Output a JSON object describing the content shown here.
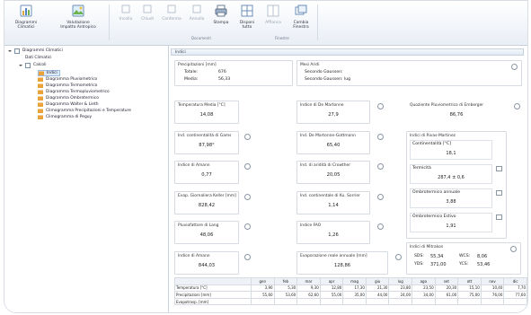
{
  "ribbon": {
    "buttons": [
      {
        "label": "Diagrammi\nClimatici",
        "icon": "chart-icon"
      },
      {
        "label": "Valutazione\nImpatto Antropico",
        "icon": "landscape-icon"
      },
      {
        "label": "Incolla",
        "icon": "paste-icon"
      },
      {
        "label": "Chiudi",
        "icon": "close-doc-icon"
      },
      {
        "label": "Conferma",
        "icon": "confirm-icon"
      },
      {
        "label": "Annulla",
        "icon": "undo-icon"
      },
      {
        "label": "Stampa",
        "icon": "print-icon"
      },
      {
        "label": "Disponi\ntutto",
        "icon": "tile-icon"
      },
      {
        "label": "Affianca",
        "icon": "side-by-side-icon"
      },
      {
        "label": "Cambia\nFinestra",
        "icon": "switch-window-icon"
      }
    ],
    "groups": [
      "Documenti",
      "Finestre"
    ]
  },
  "tree": {
    "items": [
      {
        "label": "Diagrammi Climatici",
        "icon": "document-icon",
        "level": 0,
        "expanded": true
      },
      {
        "label": "Dati Climatici",
        "icon": "none",
        "level": 1
      },
      {
        "label": "Calcoli",
        "icon": "document-icon",
        "level": 1,
        "expanded": true
      },
      {
        "label": "Indici",
        "icon": "folder-icon",
        "level": 2,
        "selected": true
      },
      {
        "label": "Diagramma Pluviometrico",
        "icon": "folder-icon",
        "level": 2
      },
      {
        "label": "Diagramma Termometrico",
        "icon": "folder-icon",
        "level": 2
      },
      {
        "label": "Diagramma Termopluviometrico",
        "icon": "folder-icon",
        "level": 2
      },
      {
        "label": "Diagramma Ombrotermico",
        "icon": "folder-icon",
        "level": 2
      },
      {
        "label": "Diagramma Walter & Lieth",
        "icon": "folder-icon",
        "level": 2
      },
      {
        "label": "Climogramma Precipitazioni e Temperature",
        "icon": "folder-icon",
        "level": 2
      },
      {
        "label": "Climogramma di Peguy",
        "icon": "folder-icon",
        "level": 2
      }
    ]
  },
  "content": {
    "header": "Indici",
    "precipitazioni": {
      "title": "Precipitazioni [mm]",
      "rows": [
        {
          "k": "Totale:",
          "v": "676"
        },
        {
          "k": "Media:",
          "v": "56,33"
        }
      ]
    },
    "mesi_aridi": {
      "title": "Mesi Aridi",
      "rows": [
        "Secondo Gaussen:",
        "Secondo Gaussen: lug"
      ]
    },
    "cards": [
      {
        "label": "Temperatura Media [°C]",
        "value": "14,08"
      },
      {
        "label": "Indice di De Martonne",
        "value": "27,9"
      },
      {
        "label": "Quoziente Pluviometrico di Emberger",
        "value": "86,76"
      },
      {
        "label": "Ind. continentalità di Gams",
        "value": "87,98°"
      },
      {
        "label": "Ind. De Martonne-Gottmann",
        "value": "65,40"
      },
      {
        "label": "Indice di Amann",
        "value": "0,77"
      },
      {
        "label": "Ind. di aridità di Crowther",
        "value": "20,05"
      },
      {
        "label": "Evap. Giornaliera Keller [mm]",
        "value": "828,42"
      },
      {
        "label": "Ind. continentale di Ku. Sorrier",
        "value": "1,14"
      },
      {
        "label": "Pluviofattore di Lang",
        "value": "48,06"
      },
      {
        "label": "Indice FAO",
        "value": "1,26"
      },
      {
        "label": "Indice di Amann",
        "value": "844,03"
      },
      {
        "label": "Evaporazione reale annuale [mm]",
        "value": "128,86"
      }
    ],
    "rivas": {
      "title": "Indici di Rivas-Martinez",
      "items": [
        {
          "label": "Continentalità [°C]",
          "value": "18,1"
        },
        {
          "label": "Termicità",
          "value": "287,4 ± 0,6"
        },
        {
          "label": "Ombrotermico annuale",
          "value": "3,88"
        },
        {
          "label": "Ombrotermico Estivo",
          "value": "1,91"
        }
      ]
    },
    "mitrakos": {
      "title": "Indici di Mitrakos",
      "rows": [
        {
          "a": "SDS:",
          "b": "55,34",
          "c": "WCS:",
          "d": "8,06"
        },
        {
          "a": "YDS:",
          "b": "371,00",
          "c": "YCS:",
          "d": "53,46"
        }
      ]
    },
    "table": {
      "headers": [
        "",
        "gen",
        "feb",
        "mar",
        "apr",
        "mag",
        "giu",
        "lug",
        "ago",
        "set",
        "ott",
        "nov",
        "dic"
      ],
      "rows": [
        {
          "label": "Temperatura [°C]",
          "values": [
            "3,90",
            "5,30",
            "9,30",
            "12,80",
            "17,30",
            "21,30",
            "23,80",
            "23,50",
            "20,30",
            "15,10",
            "10,40",
            "7,70"
          ]
        },
        {
          "label": "Precipitazioni [mm]",
          "values": [
            "55,60",
            "53,60",
            "62,60",
            "55,00",
            "35,00",
            "44,00",
            "24,00",
            "34,00",
            "61,00",
            "75,00",
            "76,00",
            "77,60"
          ]
        },
        {
          "label": "Evapotrasp. [mm]",
          "values": [
            "",
            "",
            "",
            "",
            "",
            "",
            "",
            "",
            "",
            "",
            "",
            ""
          ]
        }
      ]
    }
  }
}
